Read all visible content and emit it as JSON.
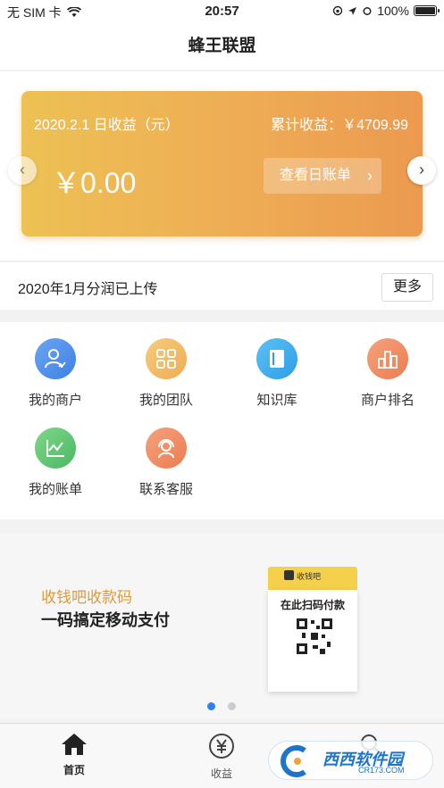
{
  "status_bar": {
    "carrier": "无 SIM 卡",
    "time": "20:57",
    "battery": "100%"
  },
  "nav": {
    "title": "蜂王联盟"
  },
  "earnings": {
    "date_label": "2020.2.1 日收益（元）",
    "total_label": "累计收益：￥4709.99",
    "amount": "￥0.00",
    "view_bill_label": "查看日账单"
  },
  "notice": {
    "text": "2020年1月分润已上传",
    "more_label": "更多"
  },
  "menu": {
    "items": [
      {
        "label": "我的商户",
        "icon": "merchant-icon"
      },
      {
        "label": "我的团队",
        "icon": "team-grid-icon"
      },
      {
        "label": "知识库",
        "icon": "book-icon"
      },
      {
        "label": "商户排名",
        "icon": "ranking-icon"
      },
      {
        "label": "我的账单",
        "icon": "chart-line-icon"
      },
      {
        "label": "联系客服",
        "icon": "customer-service-icon"
      }
    ]
  },
  "banner": {
    "tagline": "收钱吧收款码",
    "headline": "一码搞定移动支付",
    "sign_brand": "收钱吧",
    "sign_text": "在此扫码付款",
    "page_count": 2,
    "active_page": 1
  },
  "tabs": [
    {
      "label": "首页",
      "icon": "home-icon",
      "active": true
    },
    {
      "label": "收益",
      "icon": "yen-icon",
      "active": false
    }
  ],
  "watermark": {
    "text": "西西软件园",
    "url": "CR173.COM"
  },
  "colors": {
    "card_start": "#edc154",
    "card_end": "#ec9a4f",
    "tagline": "#e09a3a",
    "dot_active": "#2f80ed"
  }
}
